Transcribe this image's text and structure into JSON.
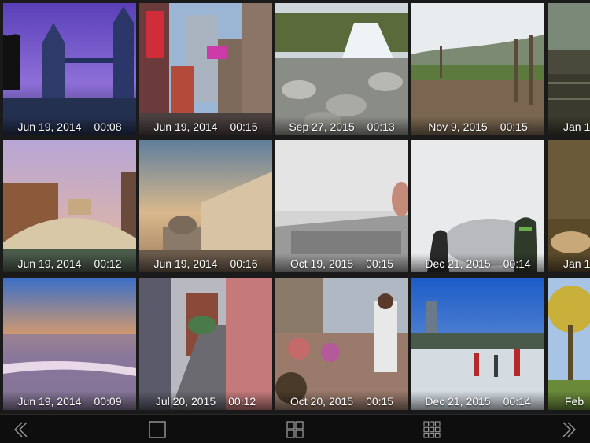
{
  "colors": {
    "toolbar_bg": "#0e0e0e",
    "icon": "#9a9a9a",
    "caption_text": "#ffffff"
  },
  "gallery": {
    "tiles": [
      {
        "date": "Jun 19, 2014",
        "duration": "00:08",
        "scene": "Tower Bridge at dusk"
      },
      {
        "date": "Jun 19, 2014",
        "duration": "00:15",
        "scene": "Times Square"
      },
      {
        "date": "Sep 27, 2015",
        "duration": "00:13",
        "scene": "Waterfall over rocks"
      },
      {
        "date": "Nov 9, 2015",
        "duration": "00:15",
        "scene": "Hillside path with fence"
      },
      {
        "date": "Jan 1",
        "duration": "",
        "scene": "Interior"
      },
      {
        "date": "Jun 19, 2014",
        "duration": "00:12",
        "scene": "Rialto Bridge"
      },
      {
        "date": "Jun 19, 2014",
        "duration": "00:16",
        "scene": "Doge's Palace"
      },
      {
        "date": "Oct 19, 2015",
        "duration": "00:15",
        "scene": "Laptop keyboard"
      },
      {
        "date": "Dec 21, 2015",
        "duration": "00:14",
        "scene": "Shoes on snow"
      },
      {
        "date": "Jan 1",
        "duration": "",
        "scene": "Water and dog"
      },
      {
        "date": "Jun 19, 2014",
        "duration": "00:09",
        "scene": "Sunset beach"
      },
      {
        "date": "Jul 20, 2015",
        "duration": "00:12",
        "scene": "City street traffic"
      },
      {
        "date": "Oct 20, 2015",
        "duration": "00:15",
        "scene": "Riverside ceremony"
      },
      {
        "date": "Dec 21, 2015",
        "duration": "00:14",
        "scene": "Ice skating rink"
      },
      {
        "date": "Feb",
        "duration": "",
        "scene": "Autumn tree"
      }
    ]
  },
  "toolbar": {
    "buttons": [
      {
        "icon": "chevron-left-icon"
      },
      {
        "icon": "single-view-icon"
      },
      {
        "icon": "grid-2x2-icon"
      },
      {
        "icon": "grid-3x3-icon"
      },
      {
        "icon": "chevron-right-icon"
      }
    ]
  }
}
